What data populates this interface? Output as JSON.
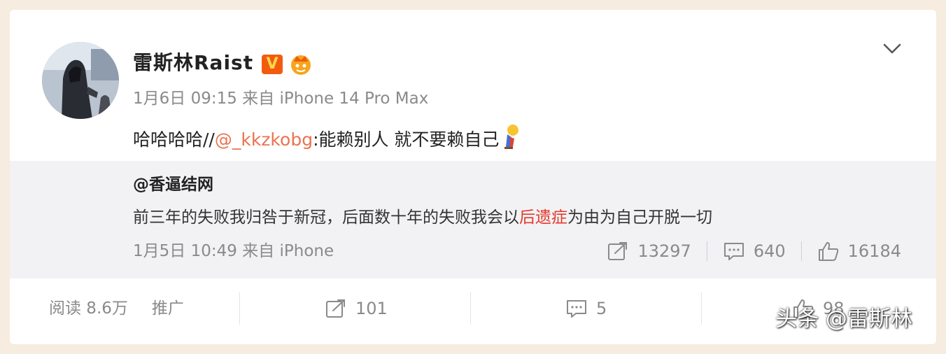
{
  "post": {
    "author_name": "雷斯林Raist",
    "verified_badge": "V",
    "meta": "1月6日 09:15 来自 iPhone 14 Pro Max",
    "text_prefix": "哈哈哈哈//",
    "mention": "@_kkzkobg",
    "text_suffix": ":能赖别人 就不要赖自己"
  },
  "repost": {
    "author": "@香逼结网",
    "text_before": "前三年的失败我归咎于新冠，后面数十年的失败我会以",
    "text_highlight": "后遗症",
    "text_after": "为由为自己开脱一切",
    "meta": "1月5日 10:49 来自 iPhone",
    "shares": "13297",
    "comments": "640",
    "likes": "16184"
  },
  "footer": {
    "reads": "阅读 8.6万",
    "promote": "推广",
    "shares": "101",
    "comments": "5",
    "likes": "98"
  },
  "watermark": "头条 @雷斯林",
  "colors": {
    "mention": "#eb7350",
    "highlight": "#e6382b",
    "badge": "#f25b0f",
    "repost_bg": "#f2f2f5",
    "page_bg": "#f6ecdf"
  },
  "icons": [
    "chevron-down-icon",
    "vip-crown-icon",
    "share-icon",
    "comment-icon",
    "like-icon",
    "emoji-icon"
  ]
}
